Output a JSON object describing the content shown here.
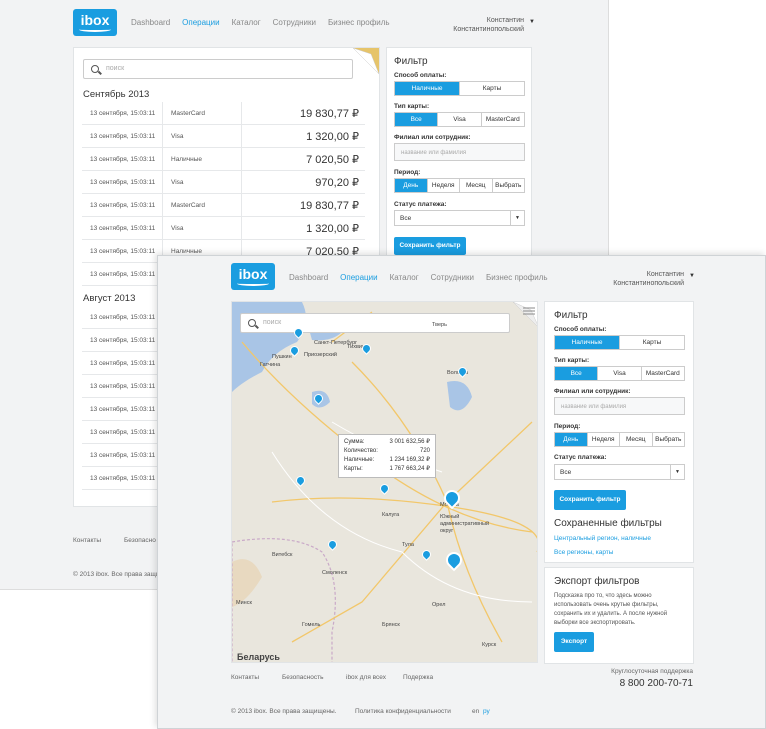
{
  "logo": {
    "text": "ibox"
  },
  "nav": [
    "Dashboard",
    "Операции",
    "Каталог",
    "Сотрудники",
    "Бизнес профиль"
  ],
  "nav_active": 1,
  "user": {
    "first": "Константин",
    "last": "Константинопольский"
  },
  "search": {
    "placeholder": "поиск"
  },
  "months": [
    "Сентябрь 2013",
    "Август 2013"
  ],
  "transactions": [
    {
      "date": "13 сентября, 15:03:11",
      "method": "MasterCard",
      "amount": "19 830,77 ₽"
    },
    {
      "date": "13 сентября, 15:03:11",
      "method": "Visa",
      "amount": "1 320,00 ₽"
    },
    {
      "date": "13 сентября, 15:03:11",
      "method": "Наличные",
      "amount": "7 020,50 ₽"
    },
    {
      "date": "13 сентября, 15:03:11",
      "method": "Visa",
      "amount": "970,20 ₽"
    },
    {
      "date": "13 сентября, 15:03:11",
      "method": "MasterCard",
      "amount": "19 830,77 ₽"
    },
    {
      "date": "13 сентября, 15:03:11",
      "method": "Visa",
      "amount": "1 320,00 ₽"
    },
    {
      "date": "13 сентября, 15:03:11",
      "method": "Наличные",
      "amount": "7 020,50 ₽"
    },
    {
      "date": "13 сентября, 15:03:11",
      "method": "",
      "amount": ""
    }
  ],
  "august_rows": [
    "13 сентября, 15:03:11",
    "13 сентября, 15:03:11",
    "13 сентября, 15:03:11",
    "13 сентября, 15:03:11",
    "13 сентября, 15:03:11",
    "13 сентября, 15:03:11",
    "13 сентября, 15:03:11",
    "13 сентября, 15:03:11"
  ],
  "filter": {
    "title": "Фильтр",
    "payment_label": "Способ оплаты:",
    "payment": [
      "Наличные",
      "Карты"
    ],
    "card_label": "Тип карты:",
    "cards": [
      "Все",
      "Visa",
      "MasterCard"
    ],
    "branch_label": "Филиал или сотрудник:",
    "branch_placeholder": "название или фамилия",
    "period_label": "Период:",
    "periods": [
      "День",
      "Неделя",
      "Месяц",
      "Выбрать"
    ],
    "status_label": "Статус платежа:",
    "status_value": "Все",
    "save": "Сохранить фильтр"
  },
  "saved": {
    "title": "Сохраненные фильтры",
    "items": [
      "Центральный регион, наличные",
      "Все регионы, карты"
    ]
  },
  "export": {
    "title": "Экспорт фильтров",
    "hint": "Подсказка про то, что здесь можно использовать очень крутые фильтры, сохранить их и удалить. А после нужной выборки все экспортировать.",
    "button": "Экспорт"
  },
  "tooltip": {
    "rows": [
      [
        "Сумма:",
        "3 001 632,56 ₽"
      ],
      [
        "Количество:",
        "720"
      ],
      [
        "Наличные:",
        "1 234 169,32 ₽"
      ],
      [
        "Карты:",
        "1 767 663,24 ₽"
      ]
    ]
  },
  "map_labels": [
    "Санкт-Петербург",
    "Гатчина",
    "Пушкин",
    "Приозерский",
    "Тихвин",
    "Вологда",
    "Москва",
    "Южный административный округ",
    "Витебск",
    "Смоленск",
    "Минск",
    "Гомель",
    "Беларусь",
    "Орел",
    "Курск",
    "Брянск",
    "Тула",
    "Калуга",
    "Тверь"
  ],
  "footer": {
    "links": [
      "Контакты",
      "Безопасность",
      "ibox для всех",
      "Подержка"
    ],
    "support_label": "Круглосуточная поддержка",
    "phone": "8 800 200-70-71",
    "copyright": "© 2013 ibox. Все права защищены.",
    "privacy": "Политика конфиденциальности",
    "langs": [
      "en",
      "ру"
    ]
  },
  "footer_back": {
    "links": [
      "Контакты",
      "Безопасно"
    ],
    "copyright": "© 2013 ibox. Все права защищ"
  }
}
